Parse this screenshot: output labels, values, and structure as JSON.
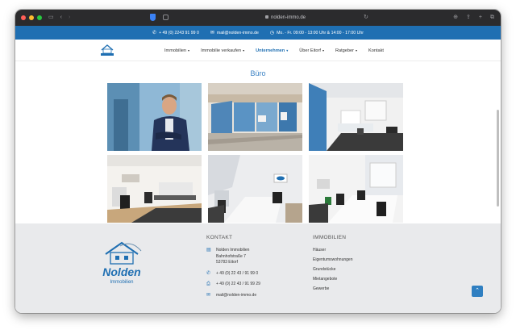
{
  "browser": {
    "url": "nolden-immo.de",
    "icons": [
      "sidebar-icon",
      "back-icon",
      "forward-icon",
      "privacy-shield-icon",
      "tab-icon",
      "reload-icon",
      "download-icon",
      "share-icon",
      "new-tab-icon",
      "tabs-overview-icon"
    ]
  },
  "topbar": {
    "phone": "+ 49 (0) 2243 91 99 0",
    "email": "mail@nolden-immo.de",
    "hours": "Mo. - Fr. 09:00 - 13:00 Uhr & 14:00 - 17:00 Uhr"
  },
  "nav": {
    "items": [
      {
        "label": "Immobilien",
        "dropdown": true,
        "active": false
      },
      {
        "label": "Immobilie verkaufen",
        "dropdown": true,
        "active": false
      },
      {
        "label": "Unternehmen",
        "dropdown": true,
        "active": true
      },
      {
        "label": "Über Eitorf",
        "dropdown": true,
        "active": false
      },
      {
        "label": "Ratgeber",
        "dropdown": true,
        "active": false
      },
      {
        "label": "Kontakt",
        "dropdown": false,
        "active": false
      }
    ]
  },
  "main": {
    "title": "Büro"
  },
  "footer": {
    "logo_text": "Nolden",
    "logo_sub": "Immobilien",
    "contact": {
      "heading": "KONTAKT",
      "company": "Nolden Immobilien",
      "street": "Bahnhofstraße 7",
      "city": "53783 Eitorf",
      "phone": "+ 49 (0) 22 43 / 91 99 0",
      "fax": "+ 49 (0) 22 43 / 91 99 29",
      "email": "mail@nolden-immo.de"
    },
    "realestate": {
      "heading": "IMMOBILIEN",
      "items": [
        "Häuser",
        "Eigentumswohnungen",
        "Grundstücke",
        "Mietangebote",
        "Gewerbe"
      ]
    }
  },
  "colors": {
    "brand_blue": "#1f6fb2",
    "title_blue": "#3b82c4",
    "footer_bg": "#e9eaec"
  }
}
